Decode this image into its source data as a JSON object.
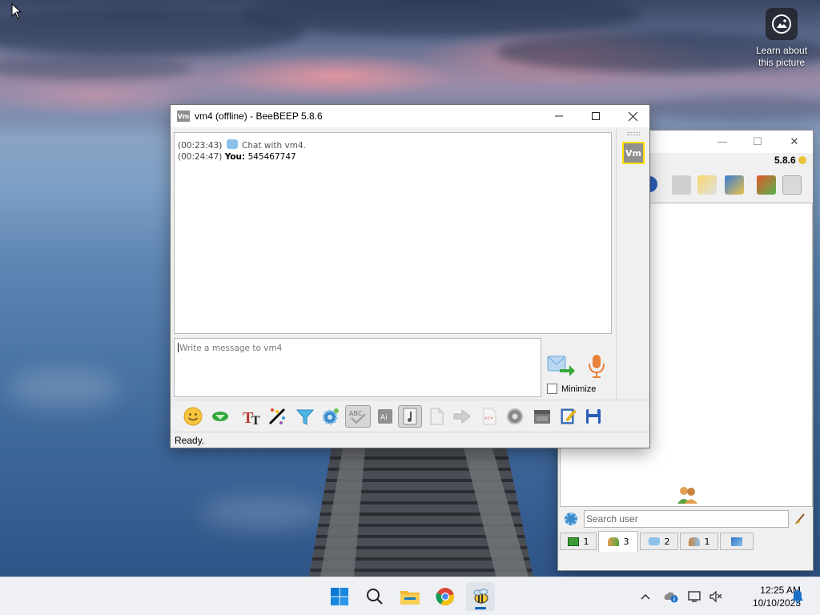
{
  "desktop": {
    "widget_label": "Learn about this picture"
  },
  "chat_window": {
    "title": "vm4 (offline) - BeeBEEP 5.8.6",
    "app_icon_text": "Vm",
    "messages": [
      {
        "time": "(00:23:43)",
        "sender": "",
        "text": "Chat with vm4."
      },
      {
        "time": "(00:24:47)",
        "sender": "You:",
        "text": "545467747"
      }
    ],
    "composer_placeholder": "Write a message to vm4",
    "minimize_label": "Minimize",
    "dock_avatar_text": "Vm",
    "status": "Ready."
  },
  "main_window": {
    "version": "5.8.6",
    "search_placeholder": "Search user",
    "tabs": [
      {
        "icon": "monitor-icon",
        "count": "1"
      },
      {
        "icon": "users-icon",
        "count": "3"
      },
      {
        "icon": "chat-icon",
        "count": "2"
      },
      {
        "icon": "group-icon",
        "count": "1"
      },
      {
        "icon": "share-icon",
        "count": ""
      }
    ]
  },
  "taskbar": {
    "time": "12:25 AM",
    "date": "10/10/2023"
  },
  "colors": {
    "accent": "#005fb8",
    "avatar_border": "#ffe100"
  }
}
